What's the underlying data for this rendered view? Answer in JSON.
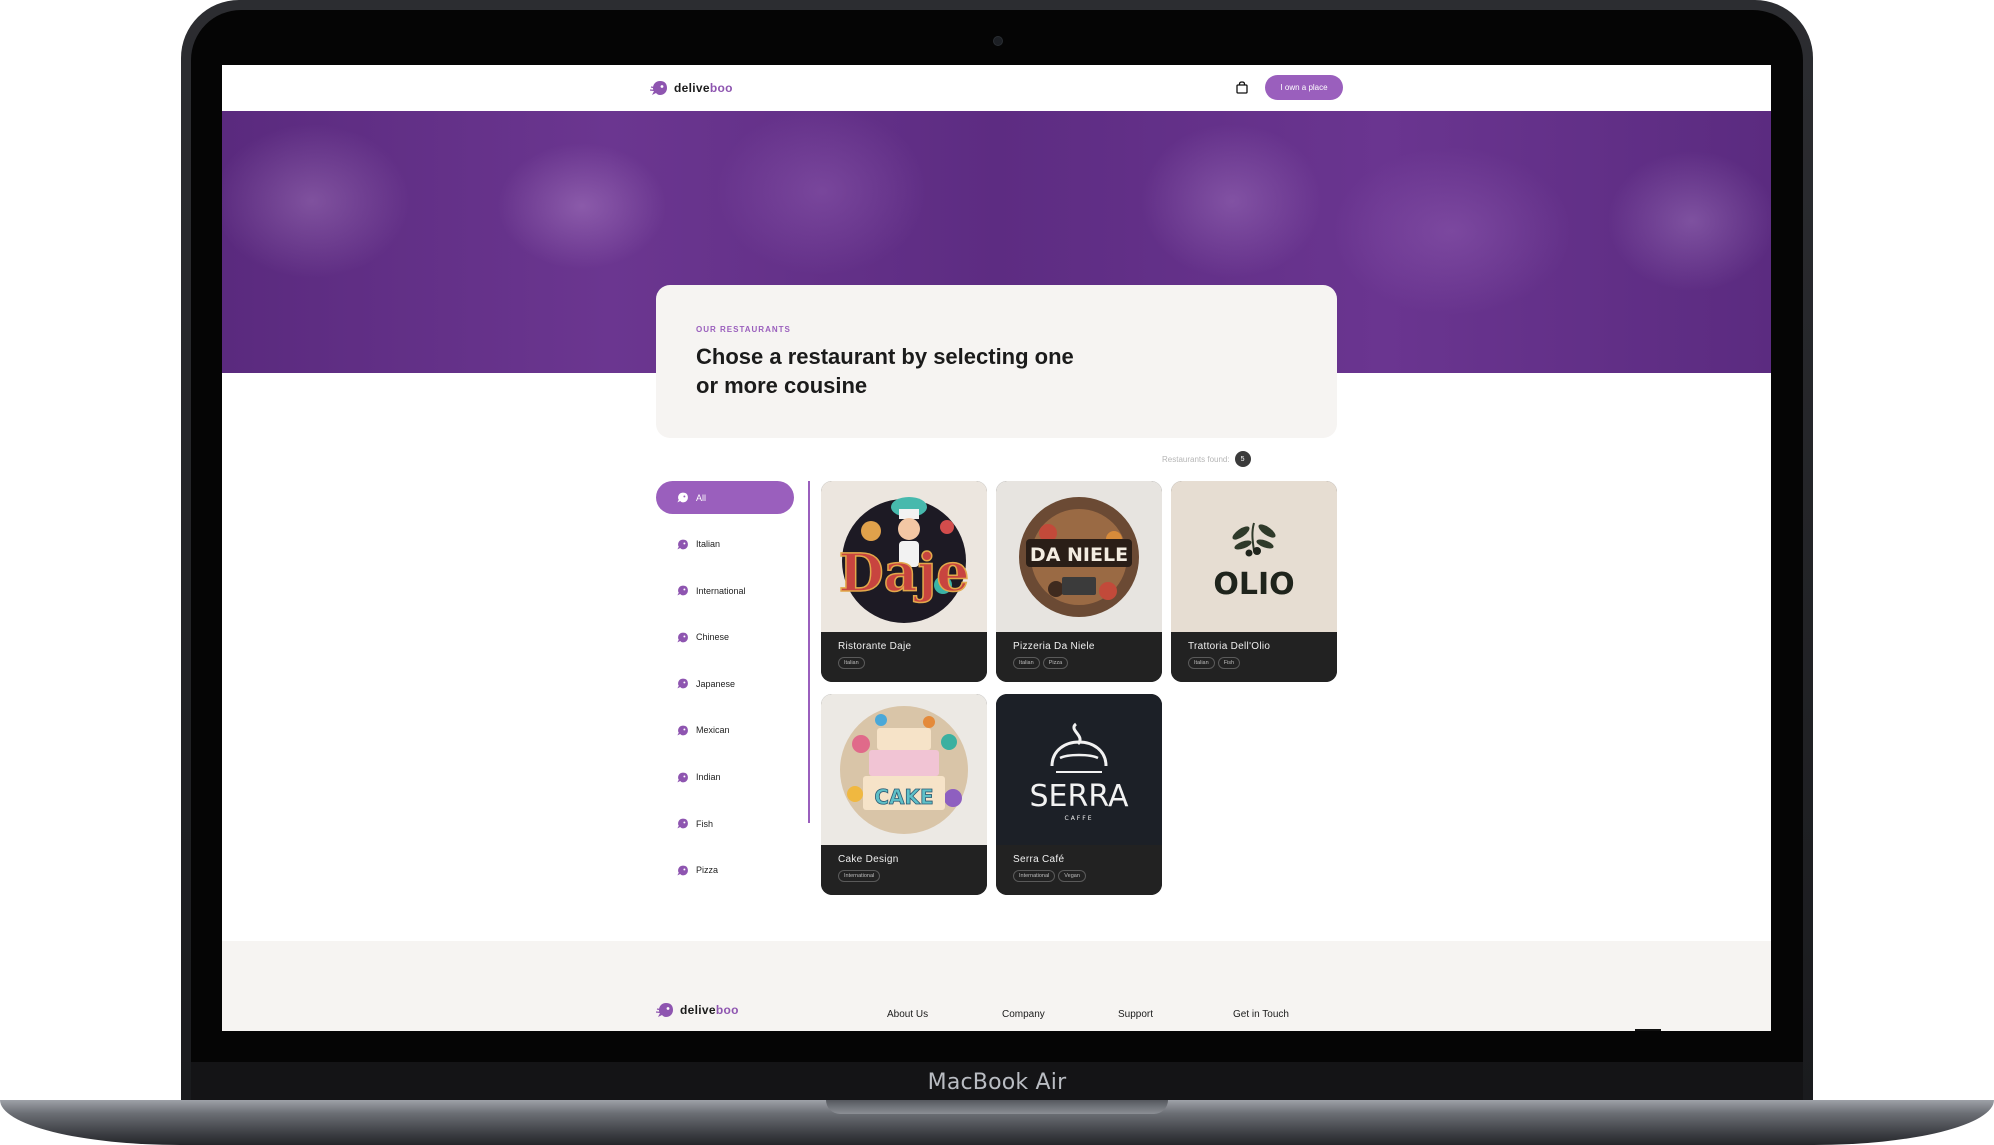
{
  "device": {
    "label": "MacBook Air"
  },
  "navbar": {
    "logo_part1": "delive",
    "logo_part2": "boo",
    "cart_icon": "shopping-bag-icon",
    "owner_button": "I own a place"
  },
  "intro": {
    "eyebrow": "OUR RESTAURANTS",
    "title": "Chose a restaurant by selecting one or more cousine"
  },
  "results": {
    "label": "Restaurants found:",
    "count": "5"
  },
  "categories": [
    {
      "label": "All",
      "active": true
    },
    {
      "label": "Italian"
    },
    {
      "label": "International"
    },
    {
      "label": "Chinese"
    },
    {
      "label": "Japanese"
    },
    {
      "label": "Mexican"
    },
    {
      "label": "Indian"
    },
    {
      "label": "Fish"
    },
    {
      "label": "Pizza"
    }
  ],
  "restaurants": [
    {
      "name": "Ristorante Daje",
      "tags": [
        "Italian"
      ],
      "logo_text": "Daje"
    },
    {
      "name": "Pizzeria Da Niele",
      "tags": [
        "Italian",
        "Pizza"
      ],
      "logo_text": "DA NIELE"
    },
    {
      "name": "Trattoria Dell'Olio",
      "tags": [
        "Italian",
        "Fish"
      ],
      "logo_text": "OLIO"
    },
    {
      "name": "Cake Design",
      "tags": [
        "International"
      ],
      "logo_text": "CAKE"
    },
    {
      "name": "Serra Café",
      "tags": [
        "International",
        "Vegan"
      ],
      "logo_text": "SERRA",
      "logo_subtext": "CAFFE"
    }
  ],
  "footer": {
    "logo_part1": "delive",
    "logo_part2": "boo",
    "links": [
      "About Us",
      "Company",
      "Support",
      "Get in Touch"
    ]
  },
  "colors": {
    "accent": "#9a5fbd",
    "hero": "#5d2c82",
    "card": "#222222",
    "panel": "#f6f4f2"
  }
}
